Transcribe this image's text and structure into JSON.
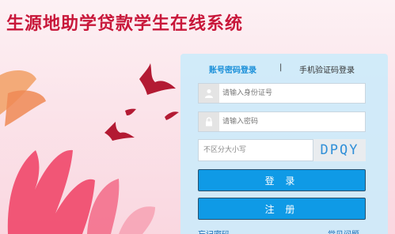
{
  "site_title": "生源地助学贷款学生在线系统",
  "login": {
    "tabs": {
      "account_password": "账号密码登录",
      "separator": "|",
      "sms_code": "手机验证码登录"
    },
    "id_field": {
      "placeholder": "请输入身份证号",
      "icon": "user-icon"
    },
    "password_field": {
      "placeholder": "请输入密码",
      "icon": "lock-icon"
    },
    "captcha": {
      "placeholder": "不区分大小写",
      "code": "DPQY"
    },
    "login_button": "登 录",
    "register_button": "注 册",
    "forgot_password": "忘记密码",
    "faq": "常见问题"
  },
  "colors": {
    "title": "#c8173a",
    "active_tab": "#1a8fd9",
    "button": "#0f9ae6",
    "captcha_text": "#2f8fd8"
  }
}
